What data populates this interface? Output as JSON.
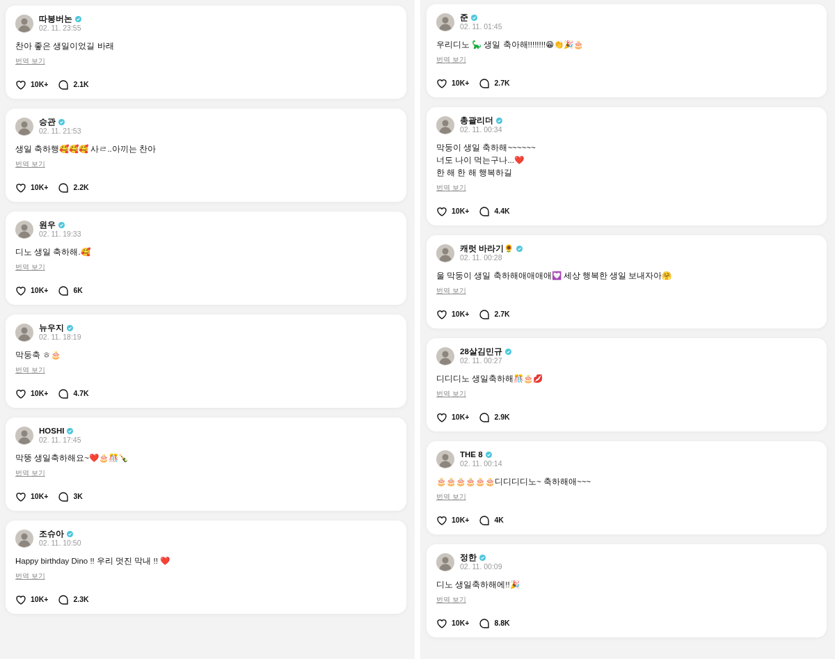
{
  "columns": [
    {
      "posts": [
        {
          "author": "따봉버논",
          "verified": true,
          "time": "02. 11. 23:55",
          "text": "찬아 좋은 생일이었길 바래",
          "translate": "번역 보기",
          "likes": "10K+",
          "comments": "2.1K"
        },
        {
          "author": "승관",
          "verified": true,
          "time": "02. 11. 21:53",
          "text": "생일 축하행🥰🥰🥰 사ㄹ..아끼는 찬아",
          "translate": "번역 보기",
          "likes": "10K+",
          "comments": "2.2K"
        },
        {
          "author": "원우",
          "verified": true,
          "time": "02. 11. 19:33",
          "text": "디노 생일 축하해.🥰",
          "translate": "번역 보기",
          "likes": "10K+",
          "comments": "6K"
        },
        {
          "author": "뉴우지",
          "verified": true,
          "time": "02. 11. 18:19",
          "text": "막둥축 ㅎ🎂",
          "translate": "번역 보기",
          "likes": "10K+",
          "comments": "4.7K"
        },
        {
          "author": "HOSHI",
          "verified": true,
          "time": "02. 11. 17:45",
          "text": "막뚱 생일축하해요~❤️🎂🎊🍾",
          "translate": "번역 보기",
          "likes": "10K+",
          "comments": "3K"
        },
        {
          "author": "조슈아",
          "verified": true,
          "time": "02. 11. 10:50",
          "text": "Happy birthday Dino !! 우리 멋진 막내 !! ❤️",
          "translate": "번역 보기",
          "likes": "10K+",
          "comments": "2.3K"
        }
      ]
    },
    {
      "posts": [
        {
          "author": "준",
          "verified": true,
          "time": "02. 11. 01:45",
          "text": "우리디노 🦕 생일 축아해!!!!!!!!😁👏🎉🎂",
          "translate": "번역 보기",
          "likes": "10K+",
          "comments": "2.7K"
        },
        {
          "author": "총괄리더",
          "verified": true,
          "time": "02. 11. 00:34",
          "text": "막둥이 생일 축하해~~~~~~\n너도 나이 먹는구나...❤️\n한 해 한 해 행복하길",
          "translate": "번역 보기",
          "likes": "10K+",
          "comments": "4.4K"
        },
        {
          "author": "캐럿 바라기🌻",
          "verified": true,
          "time": "02. 11. 00:28",
          "text": "울 막둥이 생일 축하해애애애애💟 세상 행복한 생일 보내자아🤗",
          "translate": "번역 보기",
          "likes": "10K+",
          "comments": "2.7K"
        },
        {
          "author": "28살김민규",
          "verified": true,
          "time": "02. 11. 00:27",
          "text": "디디디노 생일축하해🎊🎂💋",
          "translate": "번역 보기",
          "likes": "10K+",
          "comments": "2.9K"
        },
        {
          "author": "THE 8",
          "verified": true,
          "time": "02. 11. 00:14",
          "text": "🎂🎂🎂🎂🎂🎂디디디디노~ 축하해애~~~",
          "translate": "번역 보기",
          "likes": "10K+",
          "comments": "4K"
        },
        {
          "author": "정한",
          "verified": true,
          "time": "02. 11. 00:09",
          "text": "디노 생일축하해에!!🎉",
          "translate": "번역 보기",
          "likes": "10K+",
          "comments": "8.8K"
        }
      ]
    }
  ]
}
